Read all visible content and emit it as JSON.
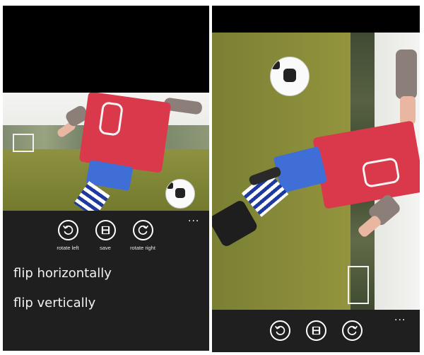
{
  "left_screen": {
    "app_bar": {
      "buttons": [
        {
          "label": "rotate left",
          "icon": "rotate-left-icon"
        },
        {
          "label": "save",
          "icon": "save-icon"
        },
        {
          "label": "rotate right",
          "icon": "rotate-right-icon"
        }
      ],
      "more": "..."
    },
    "menu": [
      {
        "label": "flip horizontally"
      },
      {
        "label": "flip vertically"
      }
    ]
  },
  "right_screen": {
    "app_bar": {
      "buttons": [
        {
          "icon": "rotate-left-icon"
        },
        {
          "icon": "save-icon"
        },
        {
          "icon": "rotate-right-icon"
        }
      ],
      "more": "..."
    }
  },
  "colors": {
    "app_bar_background": "#1f1f1f",
    "phone_background": "#000000",
    "icon_foreground": "#ffffff"
  }
}
